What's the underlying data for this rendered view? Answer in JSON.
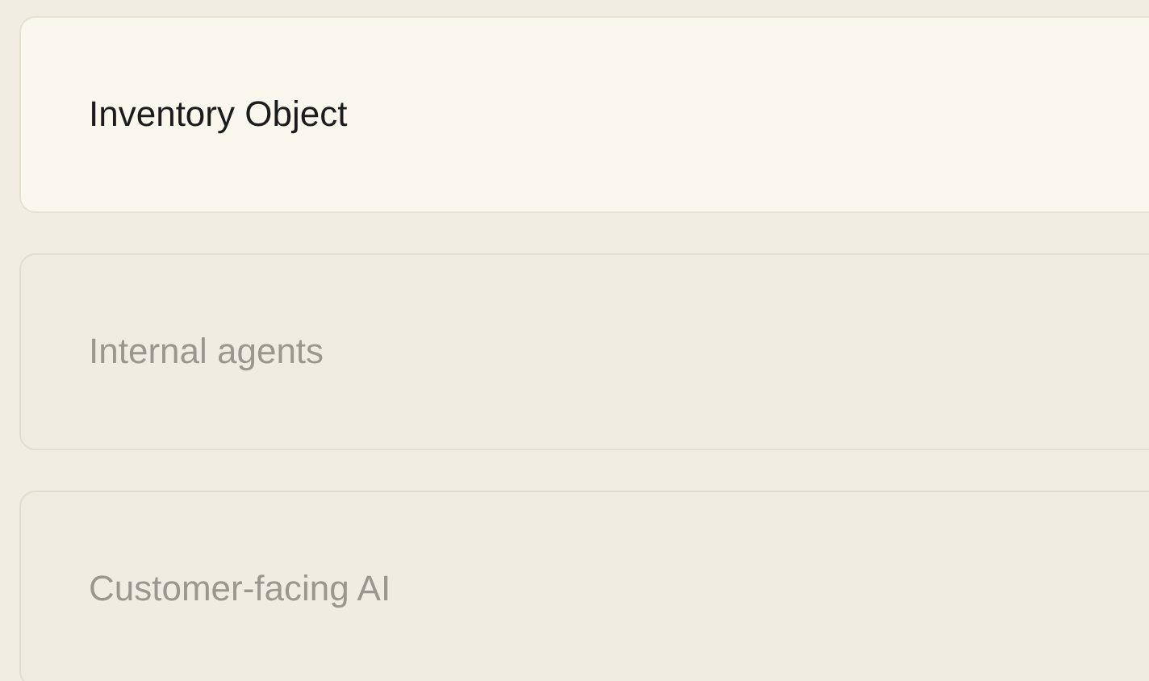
{
  "options": [
    {
      "label": "Inventory Object",
      "selected": true
    },
    {
      "label": "Internal agents",
      "selected": false
    },
    {
      "label": "Customer-facing AI",
      "selected": false
    }
  ]
}
